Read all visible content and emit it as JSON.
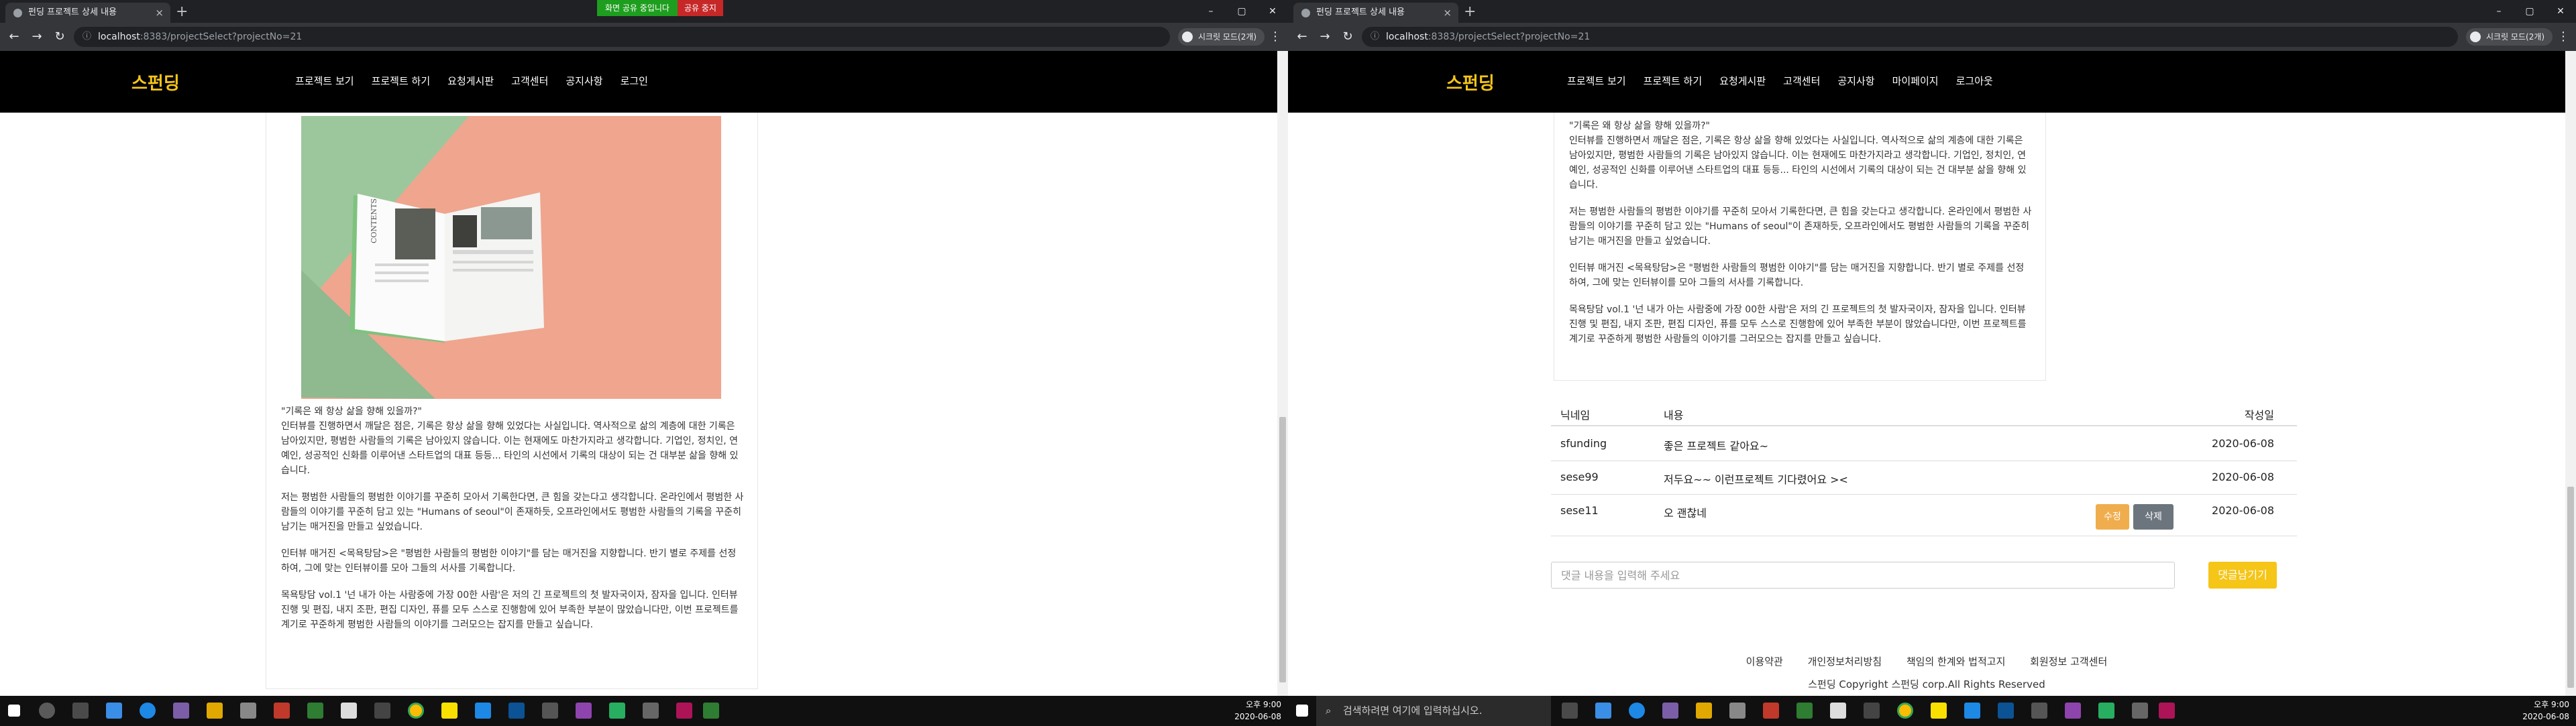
{
  "browser": {
    "tab_title": "펀딩 프로젝트 상세 내용",
    "url_host": "localhost",
    "url_rest": ":8383/projectSelect?projectNo=21",
    "profile_label": "시크릿 모드(2개)"
  },
  "screen_share": {
    "status": "화면 공유 중입니다",
    "stop": "공유 중지"
  },
  "site": {
    "logo": "스펀딩",
    "nav_left": [
      "프로젝트 보기",
      "프로젝트 하기",
      "요청게시판",
      "고객센터",
      "공지사항",
      "로그인"
    ],
    "nav_right": [
      "프로젝트 보기",
      "프로젝트 하기",
      "요청게시판",
      "고객센터",
      "공지사항",
      "마이페이지",
      "로그아웃"
    ]
  },
  "book_image": {
    "spine_text": "CONTENTS"
  },
  "article": {
    "paragraphs": [
      "\"기록은 왜 항상 삶을 향해 있을까?\"",
      "인터뷰를 진행하면서 깨달은 점은, 기록은 항상 삶을 향해 있었다는 사실입니다. 역사적으로 삶의 계층에 대한 기록은 남아있지만, 평범한 사람들의 기록은 남아있지 않습니다. 이는 현재에도 마찬가지라고 생각합니다. 기업인, 정치인, 연예인, 성공적인 신화를 이루어낸 스타트업의 대표 등등... 타인의 시선에서 기록의 대상이 되는 건 대부분 삶을 향해 있습니다.",
      "저는 평범한 사람들의 평범한 이야기를 꾸준히 모아서 기록한다면, 큰 힘을 갖는다고 생각합니다. 온라인에서 평범한 사람들의 이야기를 꾸준히 담고 있는 \"Humans of seoul\"이 존재하듯, 오프라인에서도 평범한 사람들의 기록을 꾸준히 남기는 매거진을 만들고 싶었습니다.",
      "인터뷰 매거진 <목욕탕담>은 \"평범한 사람들의 평범한 이야기\"를 담는 매거진을 지향합니다. 반기 별로 주제를 선정하여, 그에 맞는 인터뷰이를 모아 그들의 서사를 기록합니다.",
      "목욕탕담 vol.1 '넌 내가 아는 사람중에 가장 00한 사람'은 저의 긴 프로젝트의 첫 발자국이자, 잠자을 입니다. 인터뷰 진행 및 편집, 내지 조판, 편집 디자인, 퓨를 모두 스스로 진행함에 있어 부족한 부분이 많았습니다만, 이번 프로젝트를 계기로 꾸준하게 평범한 사람들의 이야기를 그러모으는 잡지를 만들고 싶습니다."
    ]
  },
  "comments": {
    "headers": {
      "nick": "닉네임",
      "content": "내용",
      "date": "작성일"
    },
    "rows": [
      {
        "nick": "sfunding",
        "content": "좋은 프로젝트 같아요~",
        "date": "2020-06-08"
      },
      {
        "nick": "sese99",
        "content": "저두요~~ 이런프로젝트 기다렸어요 ><",
        "date": "2020-06-08"
      },
      {
        "nick": "sese11",
        "content": "오 괜찮네",
        "date": "2020-06-08"
      }
    ],
    "edit_label": "수정",
    "delete_label": "삭제",
    "input_placeholder": "댓글 내용을 입력해 주세요",
    "submit_label": "댓글남기기"
  },
  "footer": {
    "links": [
      "이용약관",
      "개인정보처리방침",
      "책임의 한계와 법적고지",
      "회원정보 고객센터"
    ],
    "copyright": "스펀딩 Copyright 스펀딩 corp.All Rights Reserved"
  },
  "taskbar": {
    "search_placeholder": "검색하려면 여기에 입력하십시오.",
    "time": "오후 9:00",
    "date": "2020-06-08"
  }
}
